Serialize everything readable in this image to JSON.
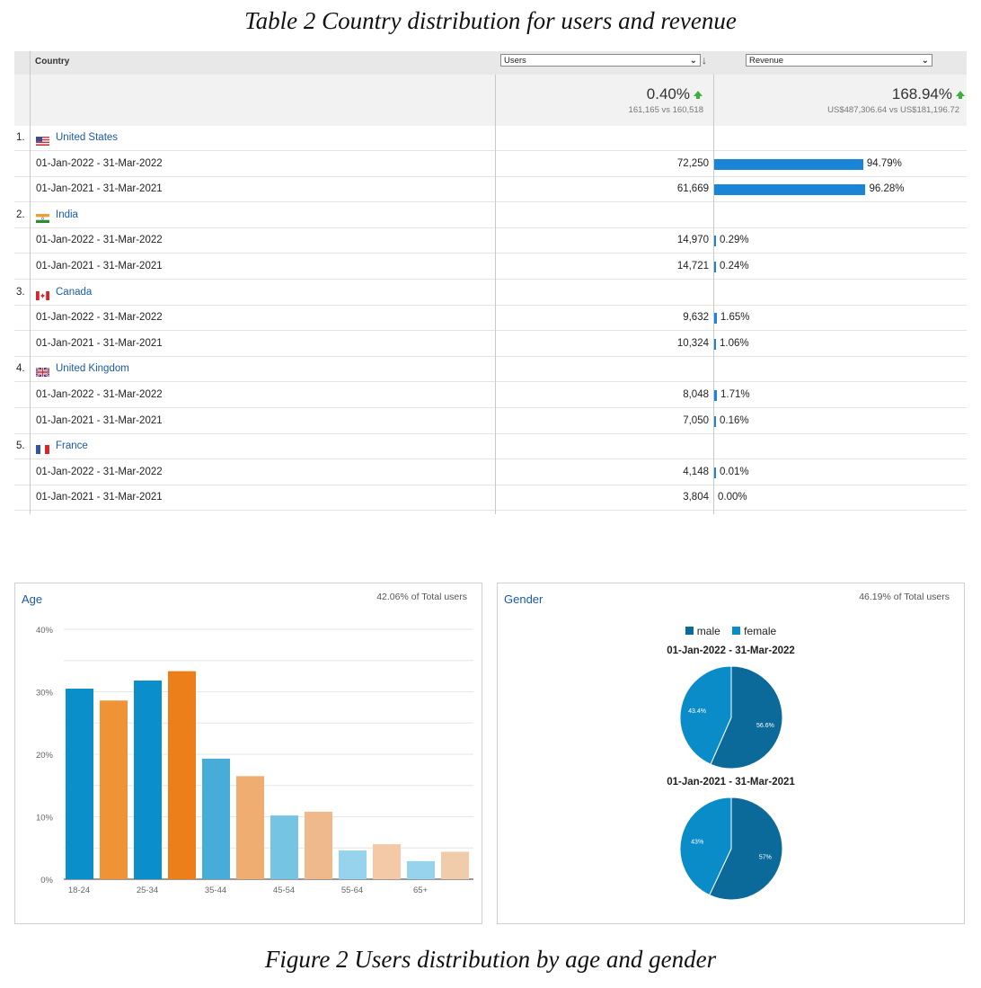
{
  "table_caption": "Table 2 Country distribution for users and revenue",
  "figure_caption": "Figure 2 Users distribution by age and gender",
  "table": {
    "header_country": "Country",
    "users_select": "Users",
    "revenue_select": "Revenue",
    "summary": {
      "users_pct": "0.40%",
      "users_sub": "161,165 vs 160,518",
      "revenue_pct": "168.94%",
      "revenue_sub": "US$487,306.64 vs US$181,196.72"
    },
    "countries": [
      {
        "rank": "1.",
        "name": "United States",
        "flag": "us",
        "rows": [
          {
            "date": "01-Jan-2022 - 31-Mar-2022",
            "users": "72,250",
            "revenue_pct": "94.79%",
            "share": 0.9479
          },
          {
            "date": "01-Jan-2021 - 31-Mar-2021",
            "users": "61,669",
            "revenue_pct": "96.28%",
            "share": 0.9628
          }
        ]
      },
      {
        "rank": "2.",
        "name": "India",
        "flag": "in",
        "rows": [
          {
            "date": "01-Jan-2022 - 31-Mar-2022",
            "users": "14,970",
            "revenue_pct": "0.29%",
            "share": 0.0029
          },
          {
            "date": "01-Jan-2021 - 31-Mar-2021",
            "users": "14,721",
            "revenue_pct": "0.24%",
            "share": 0.0024
          }
        ]
      },
      {
        "rank": "3.",
        "name": "Canada",
        "flag": "ca",
        "rows": [
          {
            "date": "01-Jan-2022 - 31-Mar-2022",
            "users": "9,632",
            "revenue_pct": "1.65%",
            "share": 0.0165
          },
          {
            "date": "01-Jan-2021 - 31-Mar-2021",
            "users": "10,324",
            "revenue_pct": "1.06%",
            "share": 0.0106
          }
        ]
      },
      {
        "rank": "4.",
        "name": "United Kingdom",
        "flag": "gb",
        "rows": [
          {
            "date": "01-Jan-2022 - 31-Mar-2022",
            "users": "8,048",
            "revenue_pct": "1.71%",
            "share": 0.0171
          },
          {
            "date": "01-Jan-2021 - 31-Mar-2021",
            "users": "7,050",
            "revenue_pct": "0.16%",
            "share": 0.0016
          }
        ]
      },
      {
        "rank": "5.",
        "name": "France",
        "flag": "fr",
        "rows": [
          {
            "date": "01-Jan-2022 - 31-Mar-2022",
            "users": "4,148",
            "revenue_pct": "0.01%",
            "share": 0.0001
          },
          {
            "date": "01-Jan-2021 - 31-Mar-2021",
            "users": "3,804",
            "revenue_pct": "0.00%",
            "share": 0.0
          }
        ]
      }
    ],
    "icons": {
      "sort": "sort-down-arrow-icon",
      "change_up": "green-up-arrow-icon",
      "dropdown": "chevron-down-icon"
    },
    "colors": {
      "revenue_bar": "#1a84d6",
      "link": "#1a5aa8",
      "increase": "#3cb03c"
    }
  },
  "age_card": {
    "title": "Age",
    "total": "42.06% of Total users"
  },
  "gender_card": {
    "title": "Gender",
    "total": "46.19% of Total users",
    "legend_male": "male",
    "legend_female": "female",
    "pie1_title": "01-Jan-2022 - 31-Mar-2022",
    "pie2_title": "01-Jan-2021 - 31-Mar-2021",
    "colors": {
      "male": "#0b6a9a",
      "female": "#0a8cc9"
    }
  },
  "chart_data": [
    {
      "type": "bar",
      "title": "Age",
      "categories": [
        "18-24",
        "25-34",
        "35-44",
        "45-54",
        "55-64",
        "65+"
      ],
      "yticks": [
        "0%",
        "10%",
        "20%",
        "30%",
        "40%"
      ],
      "ylim": [
        0,
        40
      ],
      "grid": true,
      "series": [
        {
          "values": [
            30.5,
            31.8,
            19.3,
            10.2,
            4.6,
            2.9
          ],
          "colors": [
            "#0a8fcb",
            "#0a8fcb",
            "#48acd9",
            "#75c4e4",
            "#98d3ed",
            "#98d3ed"
          ]
        },
        {
          "values": [
            28.6,
            33.3,
            16.5,
            10.8,
            5.6,
            4.4
          ],
          "colors": [
            "#ee9336",
            "#ec7f1a",
            "#f0ad72",
            "#f0b98b",
            "#f3c9a7",
            "#f1ccaa"
          ]
        }
      ]
    },
    {
      "type": "pie",
      "title": "01-Jan-2022 - 31-Mar-2022",
      "labels": [
        "male",
        "female"
      ],
      "values": [
        56.6,
        43.4
      ],
      "value_labels": [
        "56.6%",
        "43.4%"
      ]
    },
    {
      "type": "pie",
      "title": "01-Jan-2021 - 31-Mar-2021",
      "labels": [
        "male",
        "female"
      ],
      "values": [
        57,
        43
      ],
      "value_labels": [
        "57%",
        "43%"
      ]
    }
  ]
}
